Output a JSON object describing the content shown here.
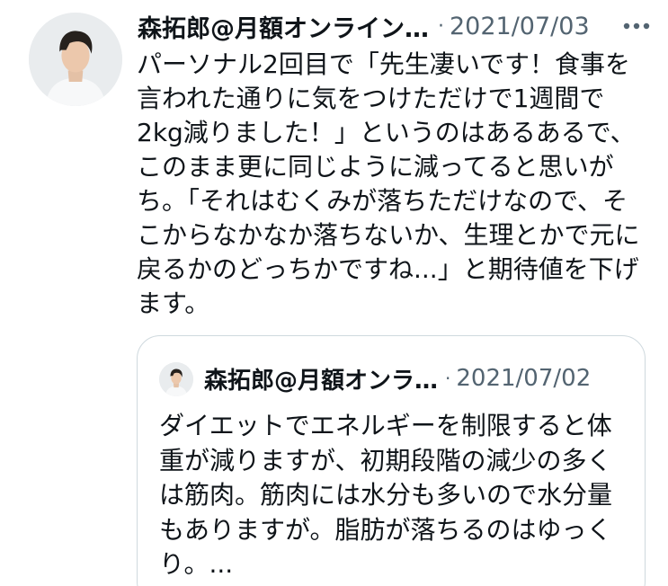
{
  "tweet": {
    "author": "森拓郎@月額オンライン…",
    "separator": "·",
    "date": "2021/07/03",
    "avatar_icon": "user-photo-avatar",
    "more_icon": "more-options-icon",
    "text_lines": [
      "パーソナル2回目で「先生凄いです！食事を",
      "言われた通りに気をつけただけで1週間で",
      "2kg減りました！」というのはあるあるで、",
      "このまま更に同じように減ってると思いが",
      "ち。「それはむくみが落ちただけなので、そ",
      "こからなかなか落ちないか、生理とかで元に",
      "戻るかのどっちかですね...」と期待値を下げ",
      "ます。"
    ]
  },
  "quoted_tweet": {
    "author": "森拓郎@月額オンラ…",
    "separator": "·",
    "date": "2021/07/02",
    "text_lines": [
      "ダイエットでエネルギーを制限すると体",
      "重が減りますが、初期段階の減少の多く",
      "は筋肉。筋肉には水分も多いので水分量",
      "もありますが。脂肪が落ちるのはゆっく",
      "り。..."
    ]
  },
  "colors": {
    "text": "#0f1419",
    "secondary": "#536471",
    "border": "#cfd9de"
  }
}
